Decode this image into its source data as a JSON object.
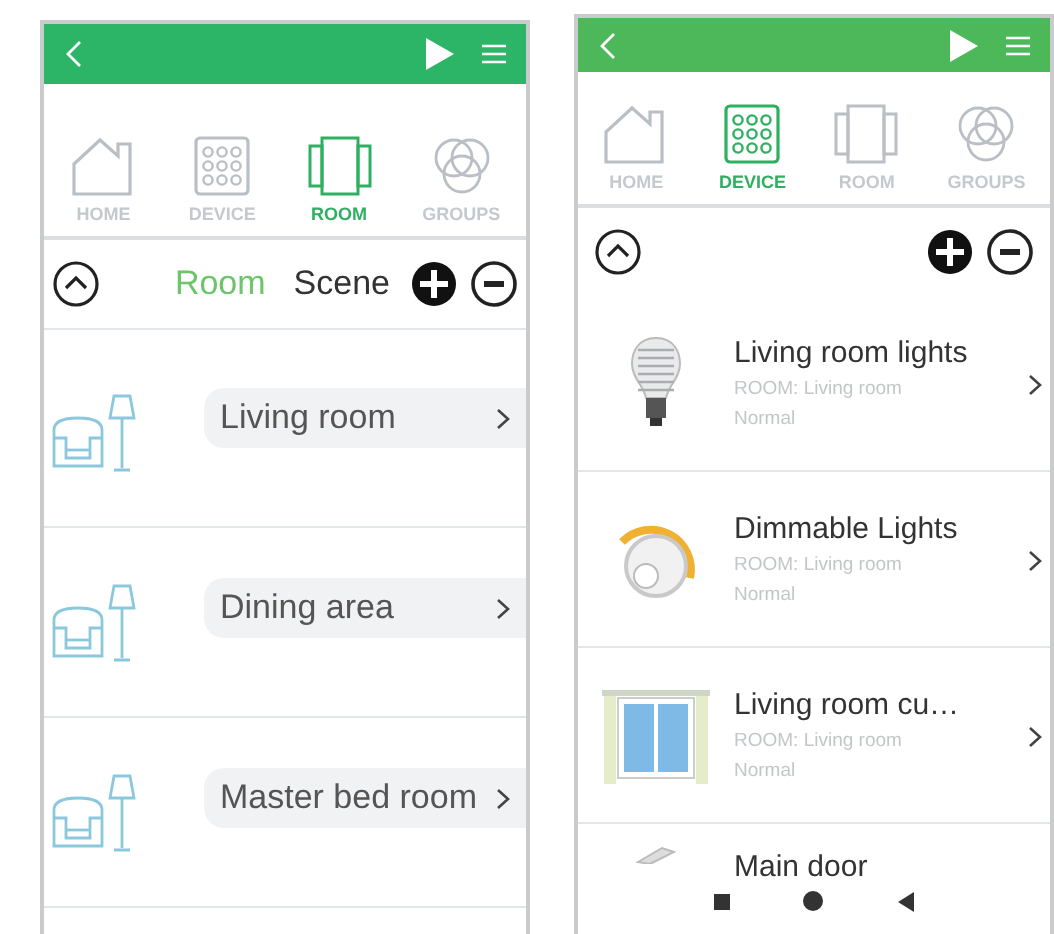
{
  "screens": [
    {
      "kind": "rooms",
      "tabs": [
        {
          "label": "HOME",
          "kind": "home",
          "selected": false
        },
        {
          "label": "DEVICE",
          "kind": "device",
          "selected": false
        },
        {
          "label": "ROOM",
          "kind": "room",
          "selected": true
        },
        {
          "label": "GROUPS",
          "kind": "groups",
          "selected": false
        }
      ],
      "segments": [
        {
          "label": "Room",
          "selected": true
        },
        {
          "label": "Scene",
          "selected": false
        }
      ],
      "rooms": [
        {
          "name": "Living room"
        },
        {
          "name": "Dining area"
        },
        {
          "name": "Master bed room"
        }
      ]
    },
    {
      "kind": "devices",
      "tabs": [
        {
          "label": "HOME",
          "kind": "home",
          "selected": false
        },
        {
          "label": "DEVICE",
          "kind": "device",
          "selected": true
        },
        {
          "label": "ROOM",
          "kind": "room",
          "selected": false
        },
        {
          "label": "GROUPS",
          "kind": "groups",
          "selected": false
        }
      ],
      "devices": [
        {
          "kind": "bulb",
          "name": "Living room lights",
          "room_label": "ROOM:",
          "room": "Living room",
          "status": "Normal"
        },
        {
          "kind": "dimmer",
          "name": "Dimmable Lights",
          "room_label": "ROOM:",
          "room": "Living room",
          "status": "Normal"
        },
        {
          "kind": "window",
          "name": "Living room cu…",
          "room_label": "ROOM:",
          "room": "Living room",
          "status": "Normal"
        },
        {
          "kind": "door",
          "name": "Main door"
        }
      ]
    }
  ]
}
